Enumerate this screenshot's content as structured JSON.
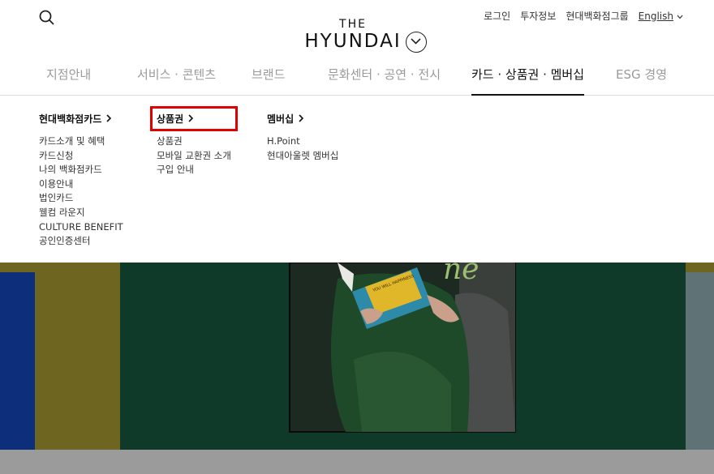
{
  "brand": {
    "line1": "THE",
    "line2": "HYUNDAI"
  },
  "util": {
    "login": "로그인",
    "investor": "투자정보",
    "group": "현대백화점그룹",
    "language": "English"
  },
  "gnb": [
    {
      "label": "지점안내"
    },
    {
      "label": "서비스 · 콘텐츠"
    },
    {
      "label": "브랜드"
    },
    {
      "label": "문화센터 · 공연 · 전시"
    },
    {
      "label": "카드 · 상품권 · 멤버십"
    },
    {
      "label": "ESG 경영"
    }
  ],
  "submenu": {
    "card": {
      "title": "현대백화점카드",
      "items": [
        "카드소개 및 혜택",
        "카드신청",
        "나의 백화점카드",
        "이용안내",
        "법인카드",
        "웰컴 라운지",
        "CULTURE BENEFIT",
        "공인인증센터"
      ]
    },
    "giftcard": {
      "title": "상품권",
      "items": [
        "상품권",
        "모바일 교환권 소개",
        "구입 안내"
      ]
    },
    "membership": {
      "title": "멤버십",
      "items": [
        "H.Point",
        "현대아울렛 멤버십"
      ]
    }
  },
  "hero": {
    "script_text": "ne",
    "book_text": "YOU WILL HAPPINESS"
  },
  "colors": {
    "nav_active": "#111111",
    "nav_inactive": "#9a9a9a",
    "highlight": "#e00000",
    "hero_green": "#0f3a2a",
    "stripe_blue": "#0d2e7a",
    "stripe_olive": "#6e6520",
    "stripe_gray": "#5f7377"
  }
}
